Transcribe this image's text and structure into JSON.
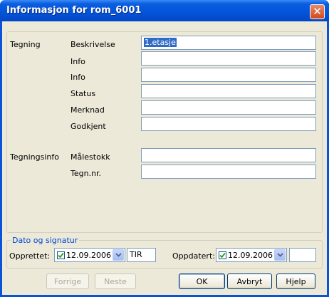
{
  "window": {
    "title": "Informasjon for rom_6001",
    "close_glyph": "✕"
  },
  "tegning": {
    "section_label": "Tegning",
    "fields": [
      {
        "label": "Beskrivelse",
        "value": "1.etasje"
      },
      {
        "label": "Info",
        "value": ""
      },
      {
        "label": "Info",
        "value": ""
      },
      {
        "label": "Status",
        "value": ""
      },
      {
        "label": "Merknad",
        "value": ""
      },
      {
        "label": "Godkjent",
        "value": ""
      }
    ]
  },
  "tegningsinfo": {
    "section_label": "Tegningsinfo",
    "fields": [
      {
        "label": "Målestokk",
        "value": ""
      },
      {
        "label": "Tegn.nr.",
        "value": ""
      }
    ]
  },
  "dato": {
    "legend": "Dato og signatur",
    "opprettet": {
      "label": "Opprettet:",
      "date": "12.09.2006",
      "checked": true,
      "signature": "TIR"
    },
    "oppdatert": {
      "label": "Oppdatert:",
      "date": "12.09.2006",
      "checked": true,
      "signature": ""
    }
  },
  "buttons": {
    "forrige": "Forrige",
    "neste": "Neste",
    "ok": "OK",
    "avbryt": "Avbryt",
    "hjelp": "Hjelp"
  },
  "icons": {
    "checkbox": "checkmark-icon",
    "dropdown": "chevron-down-icon",
    "close": "close-icon"
  },
  "colors": {
    "titlebar": "#0453d8",
    "dialog_bg": "#ece9d8",
    "legend_text": "#0046d5",
    "selection": "#316ac5"
  }
}
